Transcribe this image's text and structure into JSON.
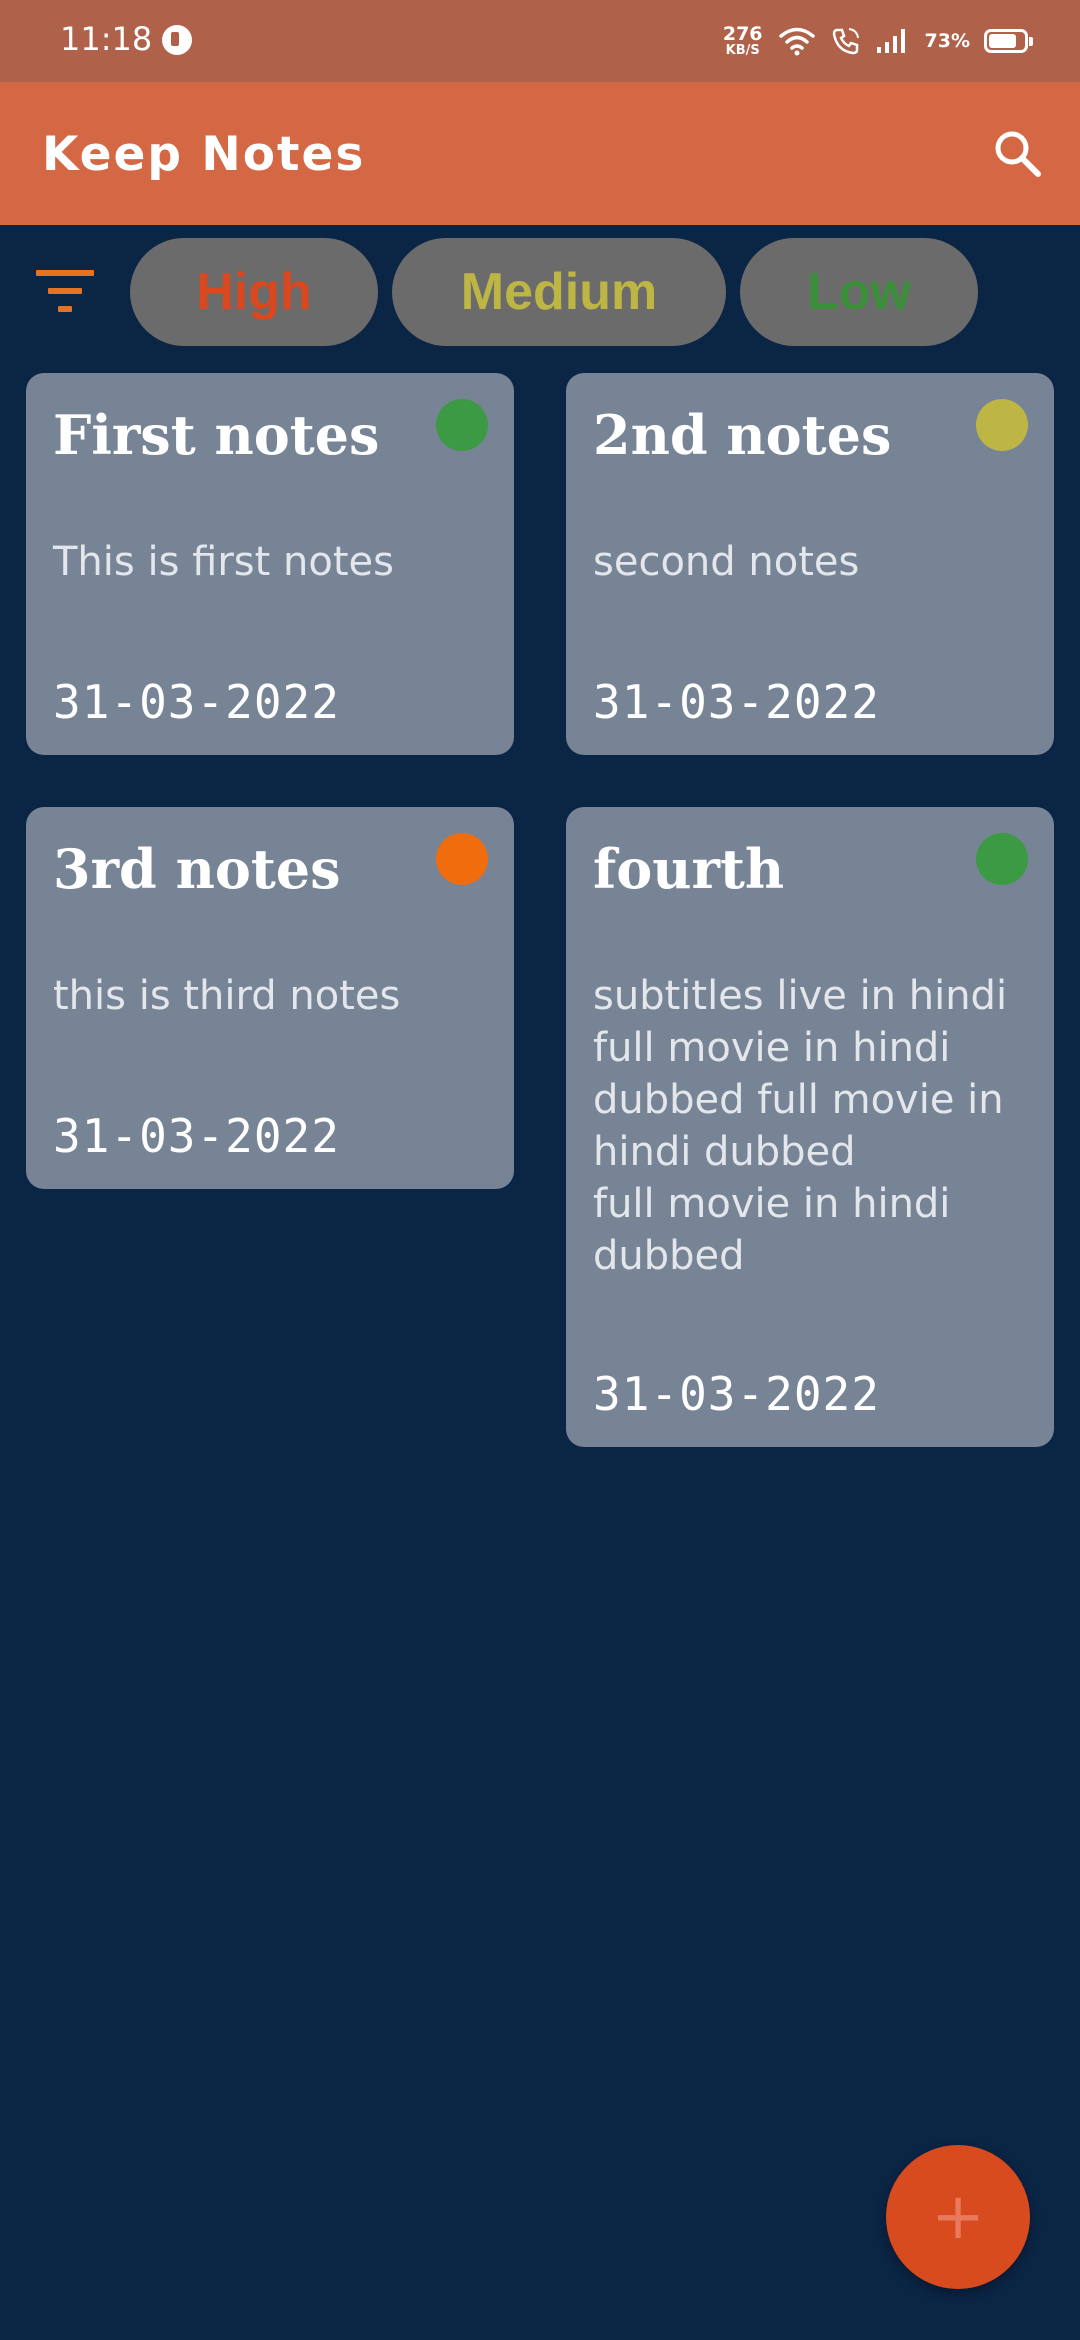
{
  "status_bar": {
    "time": "11:18",
    "net_speed_value": "276",
    "net_speed_unit": "KB/S",
    "battery_percent": "73%"
  },
  "app_bar": {
    "title": "Keep Notes",
    "search_icon": "search-icon"
  },
  "filters": {
    "filter_icon": "filter-icon",
    "chips": [
      {
        "label": "High",
        "color": "#d9481f"
      },
      {
        "label": "Medium",
        "color": "#bdb544"
      },
      {
        "label": "Low",
        "color": "#3b8f3b"
      }
    ]
  },
  "notes": [
    {
      "title": "First notes",
      "body": "This is first notes",
      "date": "31-03-2022",
      "priority_color": "#3b9a43"
    },
    {
      "title": "2nd notes",
      "body": "second notes",
      "date": "31-03-2022",
      "priority_color": "#bdb544"
    },
    {
      "title": "3rd notes",
      "body": "this is third notes",
      "date": "31-03-2022",
      "priority_color": "#f06c0c"
    },
    {
      "title": "fourth",
      "body": "subtitles live in hindi full movie in hindi dubbed full movie in hindi dubbed\nfull movie in hindi dubbed",
      "date": "31-03-2022",
      "priority_color": "#3b9a43"
    }
  ],
  "fab": {
    "icon": "add-icon",
    "glyph": "+"
  },
  "colors": {
    "background": "#0b2545",
    "app_bar": "#d46744",
    "status_bar": "#b0614a",
    "card": "#778496",
    "chip": "#6b6b6b",
    "fab": "#d84b1f"
  }
}
